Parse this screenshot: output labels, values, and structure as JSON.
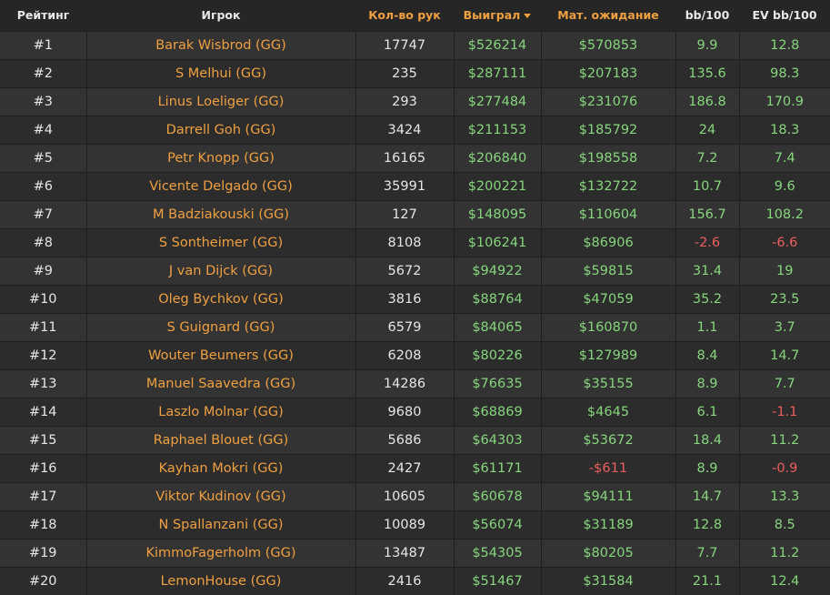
{
  "colors": {
    "background": "#262626",
    "accent": "#f0a040",
    "positive": "#86d67c",
    "negative": "#ef5d5d"
  },
  "headers": {
    "rank": "Рейтинг",
    "player": "Игрок",
    "hands": "Кол-во рук",
    "won": "Выиграл",
    "ev": "Мат. ожидание",
    "bb100": "bb/100",
    "evbb100": "EV bb/100"
  },
  "sort": {
    "column": "won",
    "direction": "desc",
    "icon": "sort-desc-icon"
  },
  "rows": [
    {
      "rank": "#1",
      "player": "Barak Wisbrod (GG)",
      "hands": "17747",
      "won": "$526214",
      "ev": "$570853",
      "bb100": "9.9",
      "evbb100": "12.8"
    },
    {
      "rank": "#2",
      "player": "S Melhui (GG)",
      "hands": "235",
      "won": "$287111",
      "ev": "$207183",
      "bb100": "135.6",
      "evbb100": "98.3"
    },
    {
      "rank": "#3",
      "player": "Linus Loeliger (GG)",
      "hands": "293",
      "won": "$277484",
      "ev": "$231076",
      "bb100": "186.8",
      "evbb100": "170.9"
    },
    {
      "rank": "#4",
      "player": "Darrell Goh (GG)",
      "hands": "3424",
      "won": "$211153",
      "ev": "$185792",
      "bb100": "24",
      "evbb100": "18.3"
    },
    {
      "rank": "#5",
      "player": "Petr Knopp (GG)",
      "hands": "16165",
      "won": "$206840",
      "ev": "$198558",
      "bb100": "7.2",
      "evbb100": "7.4"
    },
    {
      "rank": "#6",
      "player": "Vicente Delgado (GG)",
      "hands": "35991",
      "won": "$200221",
      "ev": "$132722",
      "bb100": "10.7",
      "evbb100": "9.6"
    },
    {
      "rank": "#7",
      "player": "M Badziakouski (GG)",
      "hands": "127",
      "won": "$148095",
      "ev": "$110604",
      "bb100": "156.7",
      "evbb100": "108.2"
    },
    {
      "rank": "#8",
      "player": "S Sontheimer (GG)",
      "hands": "8108",
      "won": "$106241",
      "ev": "$86906",
      "bb100": "-2.6",
      "evbb100": "-6.6"
    },
    {
      "rank": "#9",
      "player": "J van Dijck (GG)",
      "hands": "5672",
      "won": "$94922",
      "ev": "$59815",
      "bb100": "31.4",
      "evbb100": "19"
    },
    {
      "rank": "#10",
      "player": "Oleg Bychkov (GG)",
      "hands": "3816",
      "won": "$88764",
      "ev": "$47059",
      "bb100": "35.2",
      "evbb100": "23.5"
    },
    {
      "rank": "#11",
      "player": "S Guignard (GG)",
      "hands": "6579",
      "won": "$84065",
      "ev": "$160870",
      "bb100": "1.1",
      "evbb100": "3.7"
    },
    {
      "rank": "#12",
      "player": "Wouter Beumers (GG)",
      "hands": "6208",
      "won": "$80226",
      "ev": "$127989",
      "bb100": "8.4",
      "evbb100": "14.7"
    },
    {
      "rank": "#13",
      "player": "Manuel Saavedra (GG)",
      "hands": "14286",
      "won": "$76635",
      "ev": "$35155",
      "bb100": "8.9",
      "evbb100": "7.7"
    },
    {
      "rank": "#14",
      "player": "Laszlo Molnar (GG)",
      "hands": "9680",
      "won": "$68869",
      "ev": "$4645",
      "bb100": "6.1",
      "evbb100": "-1.1"
    },
    {
      "rank": "#15",
      "player": "Raphael Blouet (GG)",
      "hands": "5686",
      "won": "$64303",
      "ev": "$53672",
      "bb100": "18.4",
      "evbb100": "11.2"
    },
    {
      "rank": "#16",
      "player": "Kayhan Mokri (GG)",
      "hands": "2427",
      "won": "$61171",
      "ev": "-$611",
      "bb100": "8.9",
      "evbb100": "-0.9"
    },
    {
      "rank": "#17",
      "player": "Viktor Kudinov (GG)",
      "hands": "10605",
      "won": "$60678",
      "ev": "$94111",
      "bb100": "14.7",
      "evbb100": "13.3"
    },
    {
      "rank": "#18",
      "player": "N Spallanzani (GG)",
      "hands": "10089",
      "won": "$56074",
      "ev": "$31189",
      "bb100": "12.8",
      "evbb100": "8.5"
    },
    {
      "rank": "#19",
      "player": "KimmoFagerholm (GG)",
      "hands": "13487",
      "won": "$54305",
      "ev": "$80205",
      "bb100": "7.7",
      "evbb100": "11.2"
    },
    {
      "rank": "#20",
      "player": "LemonHouse (GG)",
      "hands": "2416",
      "won": "$51467",
      "ev": "$31584",
      "bb100": "21.1",
      "evbb100": "12.4"
    }
  ]
}
